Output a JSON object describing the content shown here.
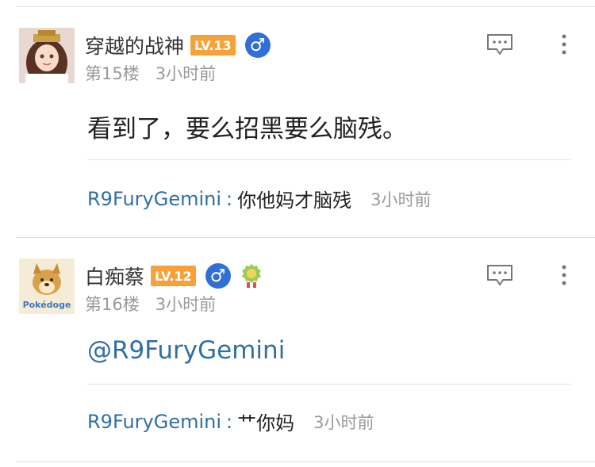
{
  "posts": [
    {
      "username": "穿越的战神",
      "level": "LV.13",
      "gender": "♂",
      "floor": "第15楼",
      "time": "3小时前",
      "content": "看到了，要么招黑要么脑残。",
      "reply": {
        "user": "R9FuryGemini",
        "colon": ":",
        "text": "你他妈才脑残",
        "time": "3小时前"
      }
    },
    {
      "username": "白痴蔡",
      "level": "LV.12",
      "gender": "♂",
      "floor": "第16楼",
      "time": "3小时前",
      "content": "@R9FuryGemini",
      "reply": {
        "user": "R9FuryGemini",
        "colon": ":",
        "text": "艹你妈",
        "time": "3小时前"
      }
    }
  ],
  "colors": {
    "link": "#2f6fa8",
    "level_badge": "#f7a13a",
    "gender_badge": "#2f6fd6",
    "meta_text": "#9a9a9a"
  }
}
